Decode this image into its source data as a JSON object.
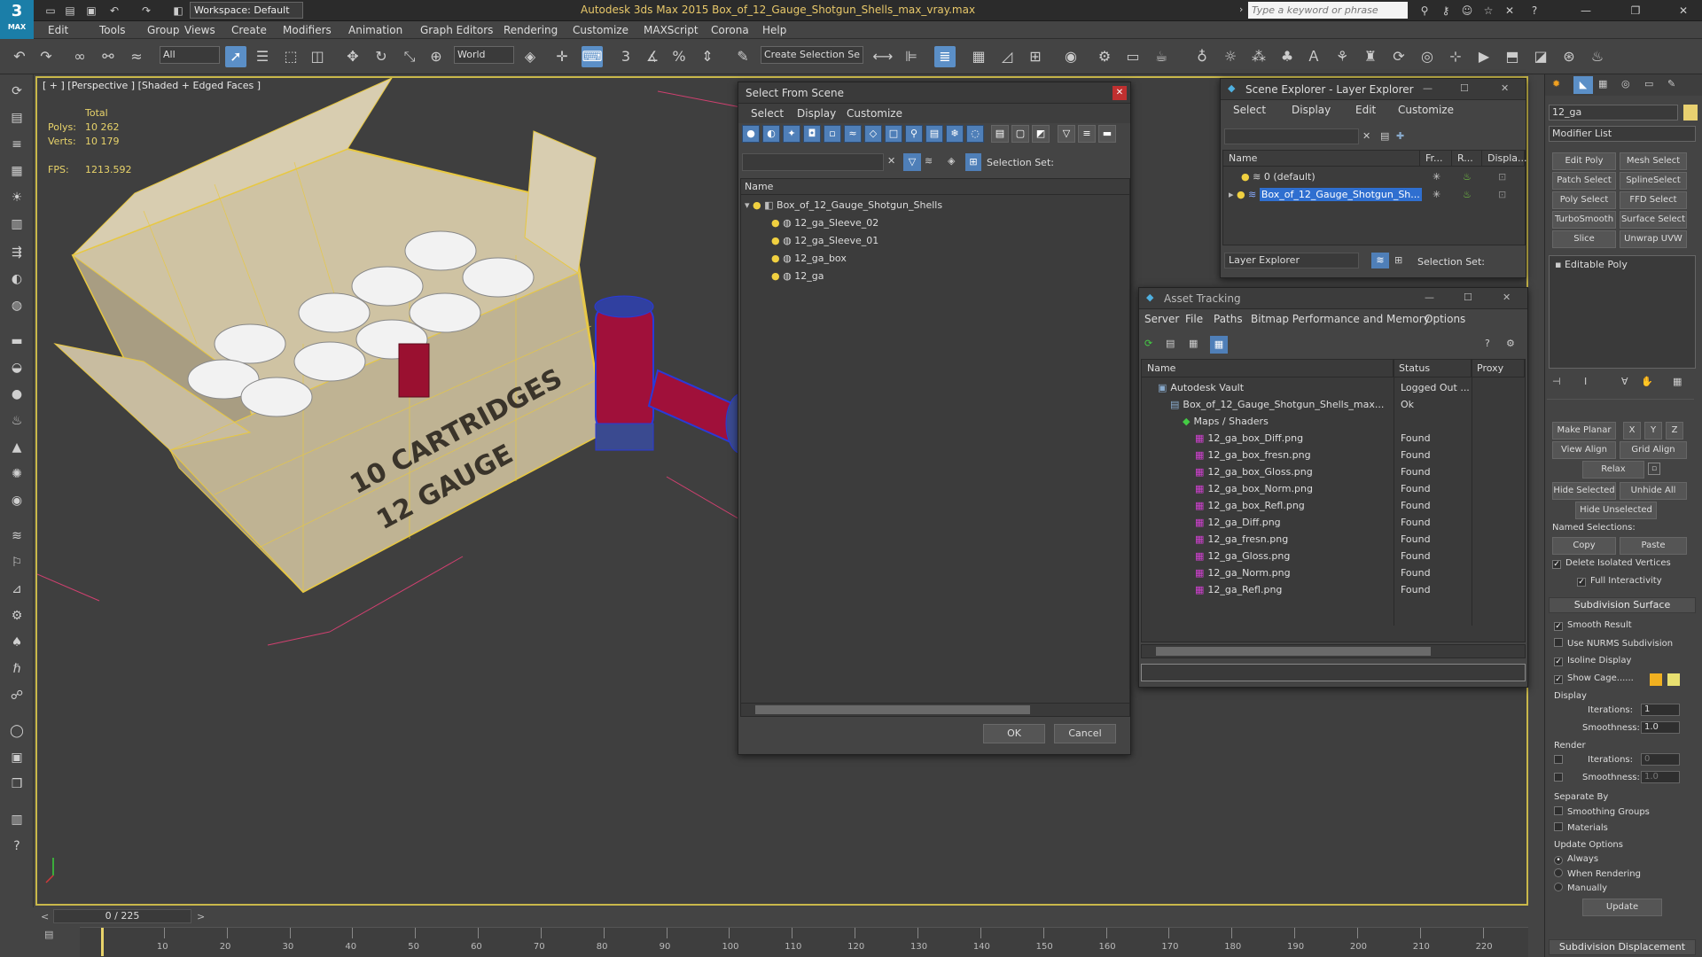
{
  "app": {
    "logo_text": "3",
    "logo_sub": "MAX",
    "workspace": "Workspace: Default",
    "title": "Autodesk 3ds Max  2015    Box_of_12_Gauge_Shotgun_Shells_max_vray.max",
    "search_placeholder": "Type a keyword or phrase"
  },
  "menu": [
    "Edit",
    "Tools",
    "Group",
    "Views",
    "Create",
    "Modifiers",
    "Animation",
    "Graph Editors",
    "Rendering",
    "Customize",
    "MAXScript",
    "Corona",
    "Help"
  ],
  "toolbar": {
    "filter_value": "All",
    "coord_value": "World",
    "selset_value": "Create Selection Se"
  },
  "viewport": {
    "label": "[ + ] [Perspective ] [Shaded + Edged Faces ]",
    "total_label": "Total",
    "polys_label": "Polys:",
    "polys_value": "10 262",
    "verts_label": "Verts:",
    "verts_value": "10 179",
    "fps_label": "FPS:",
    "fps_value": "1213.592",
    "box_text_1": "10 CARTRIDGES",
    "box_text_2": "12 GAUGE"
  },
  "select_dialog": {
    "title": "Select From Scene",
    "menu": [
      "Select",
      "Display",
      "Customize"
    ],
    "selection_set_label": "Selection Set:",
    "col_name": "Name",
    "items": [
      {
        "label": "Box_of_12_Gauge_Shotgun_Shells",
        "indent": 0
      },
      {
        "label": "12_ga_Sleeve_02",
        "indent": 1
      },
      {
        "label": "12_ga_Sleeve_01",
        "indent": 1
      },
      {
        "label": "12_ga_box",
        "indent": 1
      },
      {
        "label": "12_ga",
        "indent": 1
      }
    ],
    "ok": "OK",
    "cancel": "Cancel"
  },
  "scene_explorer": {
    "title": "Scene Explorer - Layer Explorer",
    "menu": [
      "Select",
      "Display",
      "Edit",
      "Customize"
    ],
    "col_name": "Name",
    "col_fr": "Fr...",
    "col_r": "R...",
    "col_disp": "Displa...",
    "layers": [
      "0 (default)",
      "Box_of_12_Gauge_Shotgun_Sh..."
    ],
    "footer_drop": "Layer Explorer",
    "selection_set_label": "Selection Set:"
  },
  "asset_tracking": {
    "title": "Asset Tracking",
    "menu": [
      "Server",
      "File",
      "Paths",
      "Bitmap Performance and Memory",
      "Options"
    ],
    "col_name": "Name",
    "col_status": "Status",
    "col_proxy": "Proxy Resc",
    "rows": [
      {
        "name": "Autodesk Vault",
        "status": "Logged Out ...",
        "level": 0
      },
      {
        "name": "Box_of_12_Gauge_Shotgun_Shells_max...",
        "status": "Ok",
        "level": 1
      },
      {
        "name": "Maps / Shaders",
        "status": "",
        "level": 2
      },
      {
        "name": "12_ga_box_Diff.png",
        "status": "Found",
        "level": 3
      },
      {
        "name": "12_ga_box_fresn.png",
        "status": "Found",
        "level": 3
      },
      {
        "name": "12_ga_box_Gloss.png",
        "status": "Found",
        "level": 3
      },
      {
        "name": "12_ga_box_Norm.png",
        "status": "Found",
        "level": 3
      },
      {
        "name": "12_ga_box_Refl.png",
        "status": "Found",
        "level": 3
      },
      {
        "name": "12_ga_Diff.png",
        "status": "Found",
        "level": 3
      },
      {
        "name": "12_ga_fresn.png",
        "status": "Found",
        "level": 3
      },
      {
        "name": "12_ga_Gloss.png",
        "status": "Found",
        "level": 3
      },
      {
        "name": "12_ga_Norm.png",
        "status": "Found",
        "level": 3
      },
      {
        "name": "12_ga_Refl.png",
        "status": "Found",
        "level": 3
      }
    ]
  },
  "command_panel": {
    "object_name": "12_ga",
    "modifier_list": "Modifier List",
    "mod_buttons": [
      "Edit Poly",
      "Mesh Select",
      "Patch Select",
      "SplineSelect",
      "Poly Select",
      "FFD Select",
      "TurboSmooth",
      "Surface Select",
      "Slice",
      "Unwrap UVW"
    ],
    "stack_item": "Editable Poly",
    "make_planar": "Make Planar",
    "x": "X",
    "y": "Y",
    "z": "Z",
    "view_align": "View Align",
    "grid_align": "Grid Align",
    "relax": "Relax",
    "hide_selected": "Hide Selected",
    "unhide_all": "Unhide All",
    "hide_unselected": "Hide Unselected",
    "named_selections": "Named Selections:",
    "copy": "Copy",
    "paste": "Paste",
    "delete_isolated": "Delete Isolated Vertices",
    "full_interactivity": "Full Interactivity",
    "subdiv_surface": "Subdivision Surface",
    "smooth_result": "Smooth Result",
    "use_nurms": "Use NURMS Subdivision",
    "isoline": "Isoline Display",
    "show_cage": "Show Cage......",
    "display_label": "Display",
    "iterations_label": "Iterations:",
    "iterations_value": "1",
    "smoothness_label": "Smoothness:",
    "smoothness_value": "1.0",
    "render_label": "Render",
    "r_iterations_value": "0",
    "r_smoothness_value": "1.0",
    "separate_by": "Separate By",
    "smoothing_groups": "Smoothing Groups",
    "materials": "Materials",
    "update_options": "Update Options",
    "always": "Always",
    "when_rendering": "When Rendering",
    "manually": "Manually",
    "update": "Update",
    "subdiv_displacement": "Subdivision Displacement"
  },
  "timeline": {
    "frame": "0 / 225",
    "ticks": [
      "10",
      "20",
      "30",
      "40",
      "50",
      "60",
      "70",
      "80",
      "90",
      "100",
      "110",
      "120",
      "130",
      "140",
      "150",
      "160",
      "170",
      "180",
      "190",
      "200",
      "210",
      "220"
    ]
  },
  "colors": {
    "accent_blue": "#5b8fc7",
    "viewport_border": "#c9b84a",
    "stats_yellow": "#e8d36a"
  }
}
